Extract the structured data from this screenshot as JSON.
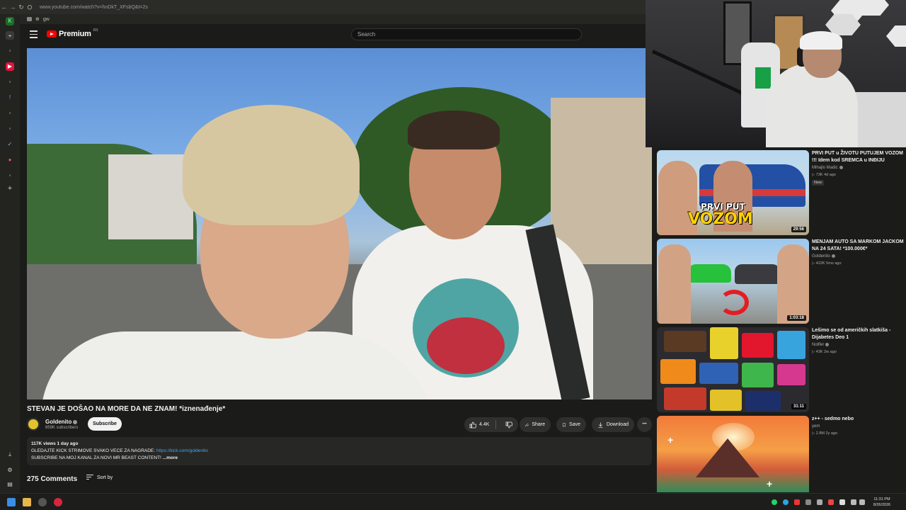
{
  "browser": {
    "url": "www.youtube.com/watch?v=hnDkT_XFsbQ&t=2s",
    "bookmark_label": "gw"
  },
  "header": {
    "logo_text": "Premium",
    "logo_region": "RS",
    "search_placeholder": "Search"
  },
  "video": {
    "title": "STEVAN JE DOŠAO NA MORE DA NE ZNAM! *iznenađenje*",
    "channel": "Goldenito",
    "subscribers": "859K subscribers",
    "subscribe_label": "Subscribe",
    "likes": "4.4K",
    "share_label": "Share",
    "save_label": "Save",
    "download_label": "Download",
    "more_symbol": "•••",
    "stats": "117K views  1 day ago",
    "description_line1": "GLEDAJTE KICK STRIMOVE SVAKO VECE ZA NAGRADE: ",
    "description_link": "https://kick.com/goldenito",
    "description_line2": "SUBSCRIBE NA MOJ KANAL ZA NOVI MR BEAST CONTENT! ",
    "description_more": "...more"
  },
  "comments": {
    "count_label": "275 Comments",
    "sort_label": "Sort by"
  },
  "recommended": [
    {
      "title": "PRVI PUT u ŽIVOTU PUTUJEM VOZOM !!! Idem kod SREMCA u INĐIJU",
      "channel": "Mihajlo Madic",
      "meta": "▷ 73K  4d ago",
      "badge": "New",
      "duration": "29:56",
      "thumb_line1": "PRVI PUT",
      "thumb_line2": "VOZOM"
    },
    {
      "title": "MENJAM AUTO SA MARKOM JACKOM NA 24 SATA! *100.000€*",
      "channel": "Goldenito",
      "meta": "▷ 422K  5mo ago",
      "duration": "1:03:18"
    },
    {
      "title": "Lešimo se od američkih slatkiša - Dijabetes Deo 1",
      "channel": "Nollfer",
      "meta": "▷ 43K  2w ago",
      "duration": "31:11"
    },
    {
      "title": "z++ - sedmo nebo",
      "channel": "yem",
      "meta": "▷ 2.8M  2y ago"
    }
  ],
  "taskbar": {
    "time": "11:31 PM",
    "date": "8/26/2026"
  },
  "colors": {
    "youtube_red": "#ff0000",
    "link_blue": "#3ea6ff",
    "background": "#1b1c1a"
  }
}
